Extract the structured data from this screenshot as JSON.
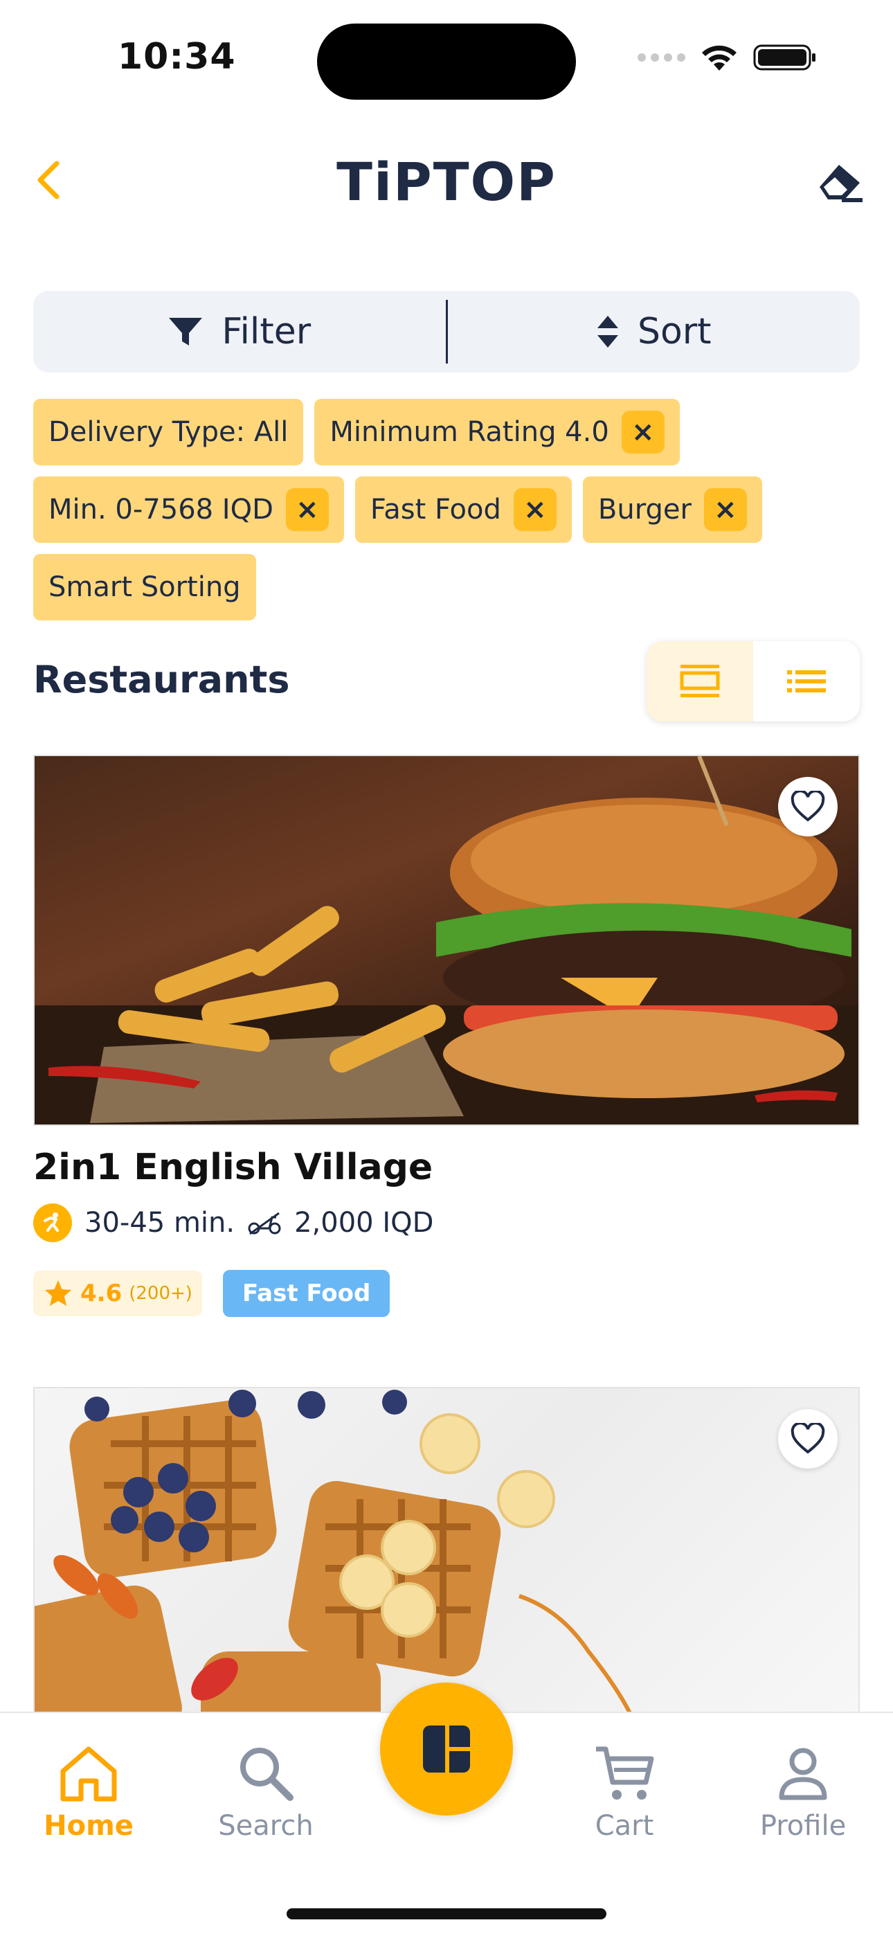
{
  "status_bar": {
    "time": "10:34"
  },
  "header": {
    "logo": "TiPTOP"
  },
  "toolbar": {
    "filter_label": "Filter",
    "sort_label": "Sort"
  },
  "chips": [
    {
      "label": "Delivery Type: All",
      "removable": false
    },
    {
      "label": "Minimum Rating 4.0",
      "removable": true
    },
    {
      "label": "Min. 0-7568 IQD",
      "removable": true
    },
    {
      "label": "Fast Food",
      "removable": true
    },
    {
      "label": "Burger",
      "removable": true
    },
    {
      "label": "Smart Sorting",
      "removable": false
    }
  ],
  "chip_remove_glyph": "×",
  "section": {
    "title": "Restaurants",
    "view_mode": "card"
  },
  "restaurants": [
    {
      "name": "2in1 English Village",
      "delivery_time": "30-45 min.",
      "delivery_fee": "2,000 IQD",
      "rating": "4.6",
      "rating_count": "(200+)",
      "cuisine": "Fast Food",
      "image": "burger"
    },
    {
      "image": "waffles"
    }
  ],
  "tabs": {
    "home": "Home",
    "search": "Search",
    "cart": "Cart",
    "profile": "Profile"
  },
  "colors": {
    "accent": "#ffb300",
    "chip_bg": "#ffd77a",
    "navy": "#1f2a44",
    "cuisine_tag": "#6ab7f5"
  }
}
